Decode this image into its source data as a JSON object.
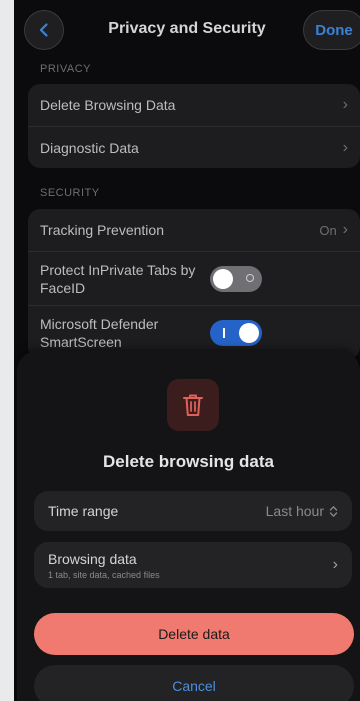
{
  "nav": {
    "title": "Privacy and Security",
    "done_label": "Done"
  },
  "privacy": {
    "section_label": "PRIVACY",
    "items": [
      {
        "label": "Delete Browsing Data"
      },
      {
        "label": "Diagnostic Data"
      }
    ]
  },
  "security": {
    "section_label": "SECURITY",
    "tracking": {
      "label": "Tracking Prevention",
      "value": "On"
    },
    "inprivate_faceid": {
      "label": "Protect InPrivate Tabs by FaceID",
      "enabled": false
    },
    "smartscreen": {
      "label": "Microsoft Defender SmartScreen",
      "enabled": true
    }
  },
  "sheet": {
    "icon": "trash-icon",
    "title": "Delete browsing data",
    "time_range": {
      "label": "Time range",
      "value": "Last hour"
    },
    "browsing_data": {
      "label": "Browsing data",
      "detail": "1 tab, site data, cached files"
    },
    "delete_label": "Delete data",
    "cancel_label": "Cancel"
  },
  "colors": {
    "accent": "#3b82d6",
    "danger": "#f07a70",
    "toggle_on": "#2563c9"
  }
}
